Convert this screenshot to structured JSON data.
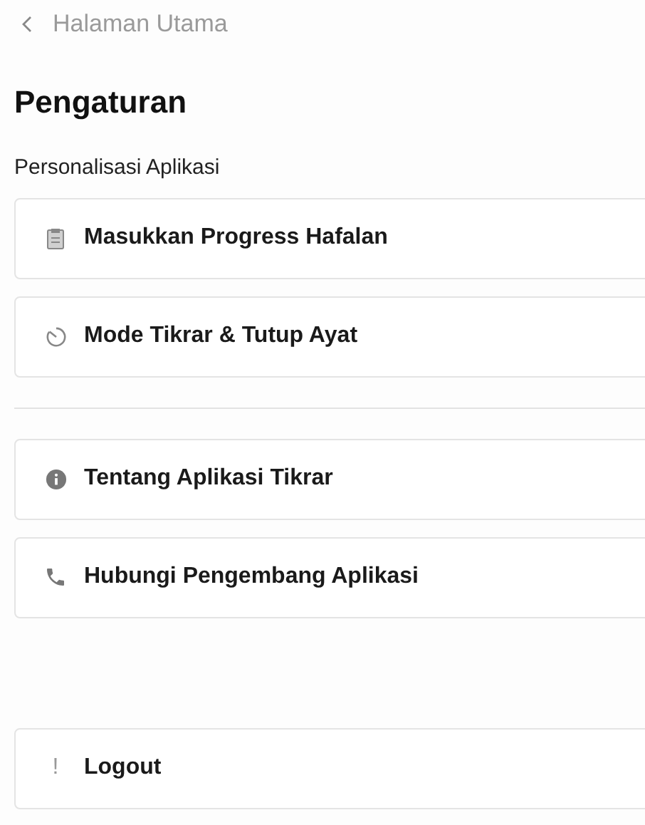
{
  "back_link": {
    "label": "Halaman Utama"
  },
  "title": "Pengaturan",
  "section_label": "Personalisasi Aplikasi",
  "groups": [
    [
      {
        "kind": "clipboard",
        "label": "Masukkan Progress Hafalan"
      },
      {
        "kind": "timer",
        "label": "Mode Tikrar & Tutup Ayat"
      }
    ],
    [
      {
        "kind": "info",
        "label": "Tentang Aplikasi Tikrar"
      },
      {
        "kind": "phone",
        "label": "Hubungi Pengembang Aplikasi"
      }
    ]
  ],
  "logout": {
    "icon": "!",
    "label": "Logout"
  }
}
